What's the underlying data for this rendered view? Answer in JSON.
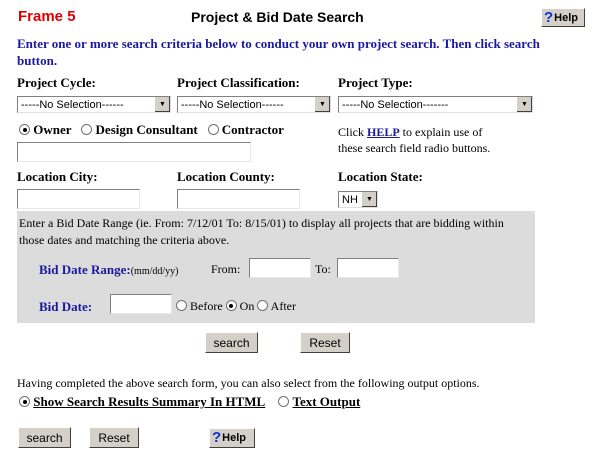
{
  "header": {
    "frame_label": "Frame 5",
    "title": "Project & Bid Date Search",
    "help_label": "Help"
  },
  "instructions": "Enter one or more search criteria below to conduct your own project search. Then click search button.",
  "criteria": {
    "project_cycle_label": "Project Cycle:",
    "project_cycle_value": "-----No Selection------",
    "project_classification_label": "Project Classification:",
    "project_classification_value": "-----No Selection------",
    "project_type_label": "Project Type:",
    "project_type_value": "-----No Selection-------",
    "role_owner": "Owner",
    "role_design": "Design Consultant",
    "role_contractor": "Contractor",
    "role_selected": "Owner",
    "role_name_value": "",
    "help_note_prefix": "Click",
    "help_note_link": "HELP",
    "help_note_suffix": "to explain use of",
    "help_note_line2": "these search field radio buttons.",
    "city_label": "Location City:",
    "city_value": "",
    "county_label": "Location County:",
    "county_value": "",
    "state_label": "Location State:",
    "state_value": "NH"
  },
  "bid_range": {
    "description": "Enter a Bid Date Range (ie. From: 7/12/01 To: 8/15/01) to display all projects that are bidding within those dates and matching the criteria above.",
    "range_label": "Bid Date Range:",
    "range_format": "(mm/dd/yy)",
    "from_label": "From:",
    "from_value": "",
    "to_label": "To:",
    "to_value": "",
    "bid_date_label": "Bid Date:",
    "bid_date_value": "",
    "before_label": "Before",
    "on_label": "On",
    "after_label": "After",
    "selected": "On"
  },
  "buttons": {
    "search": "search",
    "reset": "Reset"
  },
  "output": {
    "description": "Having completed the above search form, you can also select from the following output options.",
    "html_label": "Show Search Results Summary In HTML",
    "text_label": "Text Output",
    "selected": "html"
  },
  "footer": {
    "search": "search",
    "reset": "Reset",
    "help": "Help"
  }
}
